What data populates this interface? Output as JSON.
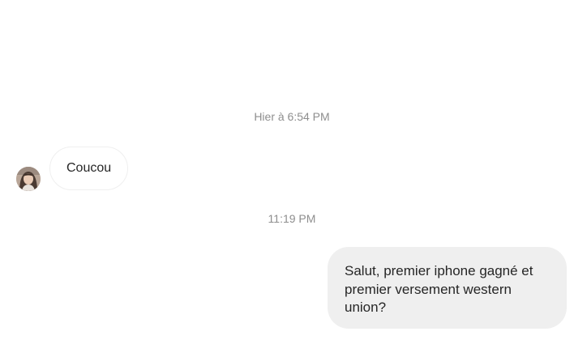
{
  "thread": {
    "timestamps": [
      "Hier à 6:54 PM",
      "11:19 PM"
    ],
    "messages": [
      {
        "direction": "incoming",
        "text": "Coucou"
      },
      {
        "direction": "outgoing",
        "text": "Salut, premier iphone gagné et premier versement western union?"
      }
    ]
  },
  "colors": {
    "timestamp": "#8e8e8e",
    "outgoing_bubble": "#efefef",
    "incoming_border": "#efefef",
    "text": "#262626"
  },
  "icons": {
    "avatar": "contact-avatar-photo"
  }
}
